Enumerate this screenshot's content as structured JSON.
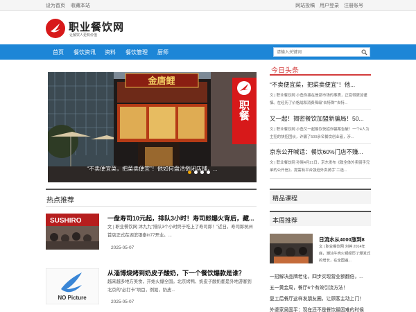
{
  "topbar": {
    "set_home": "设为首页",
    "bookmark": "收藏本站",
    "submit": "网站投稿",
    "login": "用户登录",
    "register": "注册账号"
  },
  "logo": {
    "title": "职业餐饮网",
    "subtitle": "让餐饮人更有价值"
  },
  "nav": {
    "items": [
      "首页",
      "餐饮资讯",
      "资料",
      "餐饮管理",
      "厨师"
    ],
    "search_placeholder": "请输入关键词"
  },
  "banner": {
    "sign_text": "金唐鲤",
    "logo_text": "职餐",
    "caption": "“不卖便宜菜，把菜卖便宜”！他如何盘活倒闭店铺，...",
    "dots": 4,
    "active_dot": 0
  },
  "hot": {
    "heading": "热点推荐",
    "articles": [
      {
        "title": "一盘寿司10元起，排队3小时！寿司郎爆火背后，藏...",
        "desc": "文 | 职业餐饮网 沐九九“排队3个小时终于吃上了寿司郎！”近日，寿司郎杭州首店正式在湖滨银泰in77开业。...",
        "date": "2025-05-07",
        "thumb_text": "SUSHIRO"
      },
      {
        "title": "从淄博烧烤到奶皮子酸奶，下一个餐饮爆款是谁？",
        "desc": "越来越多地方美食，开始火爆全国。北京烤鸭、奶皮子酸奶都是外地游客到北京的“必打卡”项目，例如，奶皮...",
        "date": "2025-05-07",
        "thumb_text": "NO Picture"
      }
    ]
  },
  "headlines": {
    "heading": "今日头条",
    "items": [
      {
        "title": "“不卖便宜菜，把菜卖便宜”！他...",
        "desc": "文 | 职业餐饮网 小鱼你接在是邵市场的事质，正变得更加谨慎。在经历了价格战和消费降级“去特殊”“去特..."
      },
      {
        "title": "又一起！揭密餐饮加盟新骗局！50...",
        "desc": "文 | 职业餐饮网 小鱼又一起餐饮快招诈骗案告破！一个4人为主犯的快招团伙，诈骗了500余名餐饮创业者，涉..."
      },
      {
        "title": "京东公开喊话：餐饮60%门店不赚...",
        "desc": "文 | 职业餐饮网 孙晓4月21日，京东发布《致全体外卖骑手兄弟的公开信》，提需有平台强迫外卖骑手“二选..."
      }
    ]
  },
  "courses": {
    "heading": "精品课程"
  },
  "weekly": {
    "heading": "本周推荐",
    "featured": {
      "title": "日流水从4000涨到8",
      "desc": "文 | 职业餐饮网 刘婷 2014年底，潮汕牛肉火锅经历了爆发式的增长，在全国遍..."
    },
    "list": [
      "一招解决品牌老化，四步实现营业额翻倍，...",
      "五一黄金周，餐厅6个有效引流方法！",
      "复工后餐厅这样发朋友圈，让顾客主动上门！",
      "外婆家吴国平：现在还不是餐饮最困难的时候"
    ]
  },
  "colors": {
    "nav_blue": "#1d86d7",
    "brand_red": "#d7191a",
    "headline_red": "#d33b3b",
    "active_dot": "#f0a400"
  }
}
